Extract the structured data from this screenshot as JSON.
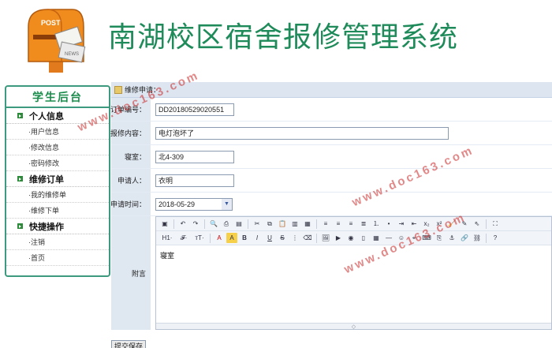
{
  "header": {
    "title": "南湖校区宿舍报修管理系统",
    "logo_icon": "mailbox-logo"
  },
  "sidebar": {
    "title": "学生后台",
    "groups": [
      {
        "label": "个人信息",
        "items": [
          "·用户信息",
          "·修改信息",
          "·密码修改"
        ]
      },
      {
        "label": "维修订单",
        "items": [
          "·我的维修单",
          "·维修下单"
        ]
      },
      {
        "label": "快捷操作",
        "items": [
          "·注销",
          "·首页"
        ]
      }
    ]
  },
  "form": {
    "section_title": "维修申请：",
    "order_label": "订单编号：",
    "order_value": "DD20180529020551",
    "content_label": "报修内容：",
    "content_value": "电灯泡坏了",
    "dorm_label": "寝室：",
    "dorm_value": "北4-309",
    "applicant_label": "申请人：",
    "applicant_value": "衣明",
    "date_label": "申请时间：",
    "date_value": "2018-05-29",
    "remark_label": "附言",
    "remark_value": "寝室",
    "submit_label": "提交保存"
  },
  "editor": {
    "heading_label": "H1·",
    "font_label": "𝓕·",
    "size_label": "тT·"
  },
  "watermark": {
    "text": "www.doc163.com"
  },
  "colors": {
    "brand_green": "#1f8a5a",
    "sidebar_border": "#3e9a7f",
    "label_bg": "#dfe7f1",
    "watermark": "#c82828"
  }
}
